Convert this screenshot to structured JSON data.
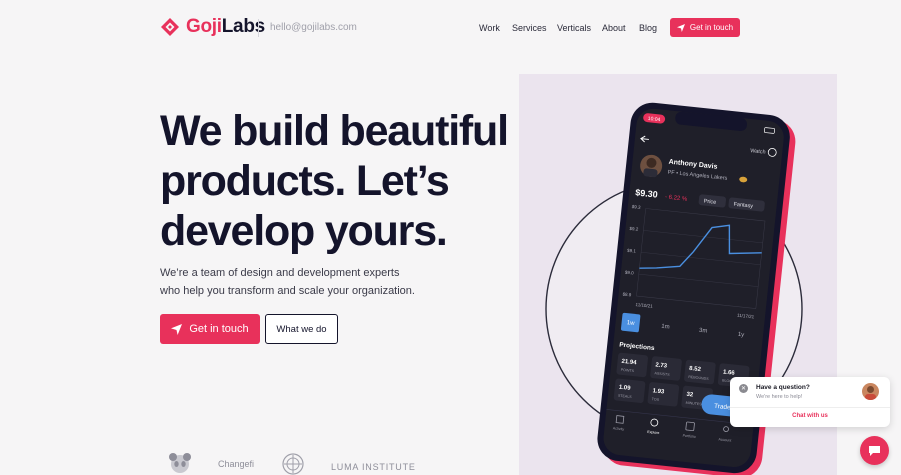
{
  "header": {
    "logo_prefix": "Goji",
    "logo_suffix": "Labs",
    "email": "hello@gojilabs.com",
    "nav": [
      "Work",
      "Services",
      "Verticals",
      "About",
      "Blog"
    ],
    "cta_label": "Get in touch"
  },
  "hero": {
    "headline_lines": [
      "We build beautiful",
      "products. Let’s",
      "develop yours."
    ],
    "subtext_lines": [
      "We’re a team of design and development experts",
      "who help you transform and scale your organization."
    ],
    "primary_button": "Get in touch",
    "secondary_button": "What we do"
  },
  "clients": [
    "Changefi",
    "LUMA INSTITUTE"
  ],
  "phone": {
    "time": "10:04",
    "watch_label": "Watch",
    "player_name": "Anthony Davis",
    "player_team": "PF • Los Angeles Lakers",
    "price": "$9.30",
    "change": "- 6.22 %",
    "dropdown_price": "Price",
    "dropdown_fantasy": "Fantasy",
    "axis_labels": [
      "$9.3",
      "$9.2",
      "$9.1",
      "$9.0",
      "$8.9"
    ],
    "date_start": "11/10/21",
    "date_end": "11/17/21",
    "ranges": [
      "1w",
      "1m",
      "3m",
      "1y"
    ],
    "projections_title": "Projections",
    "stats": [
      {
        "value": "21.94",
        "label": "POINTS"
      },
      {
        "value": "2.73",
        "label": "ASSISTS"
      },
      {
        "value": "8.52",
        "label": "REBOUNDS"
      },
      {
        "value": "1.66",
        "label": "BLOCKS"
      },
      {
        "value": "1.09",
        "label": "STEALS"
      },
      {
        "value": "1.93",
        "label": "TOS"
      },
      {
        "value": "32",
        "label": "MINUTES"
      }
    ],
    "trade_label": "Trade",
    "tabs": [
      "Activity",
      "Explore",
      "Portfolio",
      "Account"
    ]
  },
  "chat": {
    "title": "Have a question?",
    "subtitle": "We're here to help!",
    "link": "Chat with us"
  },
  "colors": {
    "brand": "#e8315b",
    "ink": "#14142b",
    "panel": "#ebe4ee",
    "phone_screen": "#1f1f29",
    "chart_line": "#4a8fe0"
  }
}
